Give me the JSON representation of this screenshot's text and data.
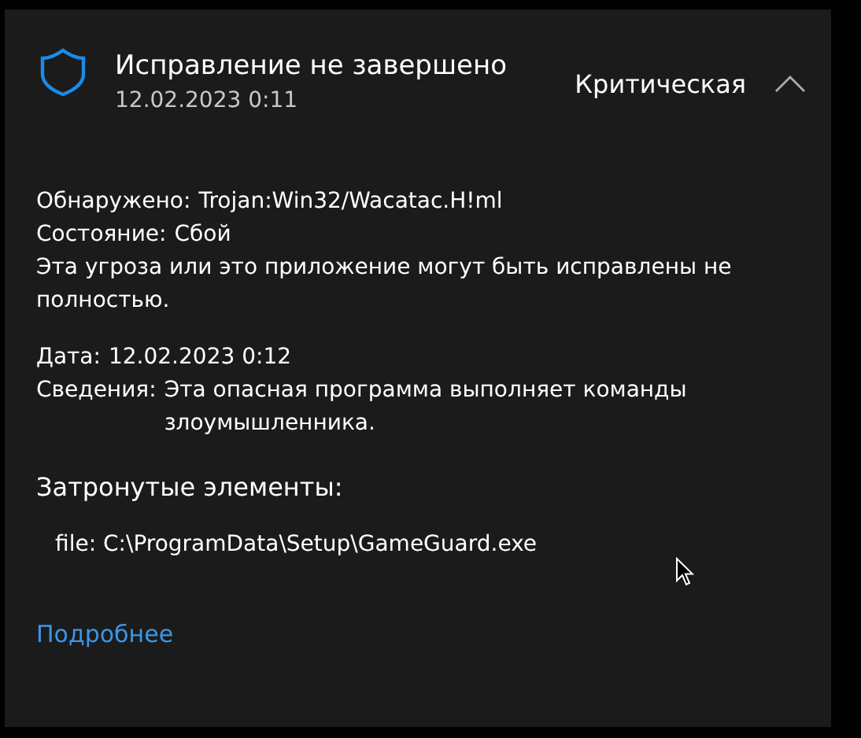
{
  "alert": {
    "title": "Исправление не завершено",
    "time": "12.02.2023 0:11",
    "severity": "Критическая",
    "expanded": true
  },
  "details": [
    {
      "label": "Обнаружено:",
      "value": "Trojan:Win32/Wacatac.H!ml"
    },
    {
      "label": "Состояние:",
      "value": "Сбой"
    }
  ],
  "note": "Эта угроза или это приложение могут быть исправлены не полностью.",
  "details2": [
    {
      "label": "Дата:",
      "value": "12.02.2023 0:12"
    },
    {
      "label": "Сведения:",
      "value": "Эта опасная программа выполняет команды злоумышленника."
    }
  ],
  "affected": {
    "heading": "Затронутые элементы:",
    "items": [
      "file: C:\\ProgramData\\Setup\\GameGuard.exe"
    ]
  },
  "link": "Подробнее"
}
